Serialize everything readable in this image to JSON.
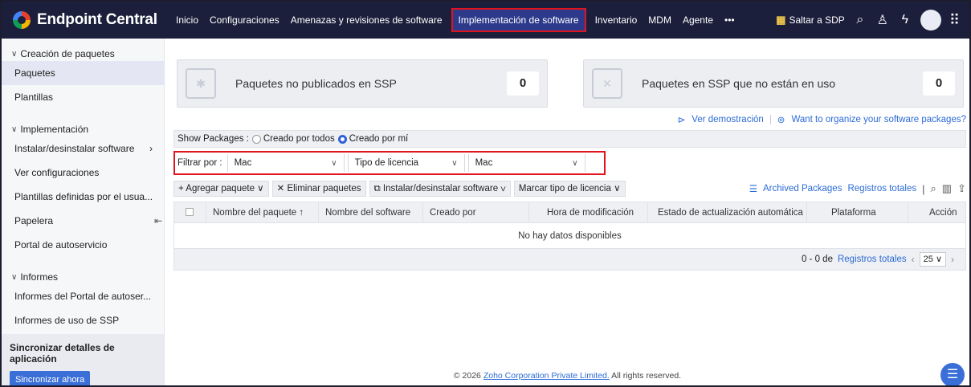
{
  "app": {
    "brand": "Endpoint Central",
    "nav": [
      "Inicio",
      "Configuraciones",
      "Amenazas y revisiones de software",
      "Implementación de software",
      "Inventario",
      "MDM",
      "Agente",
      "•••"
    ],
    "jump_sdp": "Saltar a SDP",
    "icons": {
      "sdp": "sdp-icon",
      "search": "search-icon",
      "alarm": "bell-icon",
      "bolt": "bolt-icon",
      "apps": "apps-grid-icon"
    }
  },
  "sidebar": {
    "section1": "Creación de paquetes",
    "s1_items": [
      "Paquetes",
      "Plantillas"
    ],
    "section2": "Implementación",
    "s2_items": [
      "Instalar/desinstalar software",
      "Ver configuraciones",
      "Plantillas definidas por el usua...",
      "Papelera",
      "Portal de autoservicio"
    ],
    "section3": "Informes",
    "s3_items": [
      "Informes del Portal de autoser...",
      "Informes de uso de SSP"
    ],
    "sync_title": "Sincronizar detalles de aplicación",
    "sync_button": "Sincronizar ahora"
  },
  "cards": [
    {
      "label": "Paquetes no publicados en SSP",
      "count": "0"
    },
    {
      "label": "Paquetes en SSP que no están en uso",
      "count": "0"
    }
  ],
  "links": {
    "demo": "Ver demostración",
    "organize": "Want to organize your software packages?"
  },
  "show_packages": {
    "label": "Show Packages :",
    "options": [
      "Creado por todos",
      "Creado por mí"
    ],
    "selected": "Creado por mí"
  },
  "filter": {
    "label": "Filtrar por :",
    "values": [
      "Mac",
      "Tipo de licencia",
      "Mac"
    ]
  },
  "toolbar": {
    "add": "Agregar paquete",
    "delete": "Eliminar paquetes",
    "install": "Instalar/desinstalar software",
    "license": "Marcar tipo de licencia",
    "archived": "Archived Packages",
    "total": "Registros totales"
  },
  "table": {
    "columns": [
      "Nombre del paquete",
      "Nombre del software",
      "Creado por",
      "Hora de modificación",
      "Estado de actualización automática",
      "Plataforma",
      "Acción"
    ],
    "sort_arrow": "↑",
    "empty": "No hay datos disponibles",
    "footer_range": "0 - 0 de",
    "footer_total": "Registros totales",
    "page_size": "25"
  },
  "footer": {
    "prefix": "© 2026",
    "company": "Zoho Corporation Private Limited.",
    "suffix": "All rights reserved."
  },
  "colors": {
    "topbar": "#1b1f3b",
    "accent": "#2c6bd6",
    "highlight": "#e0141e"
  }
}
